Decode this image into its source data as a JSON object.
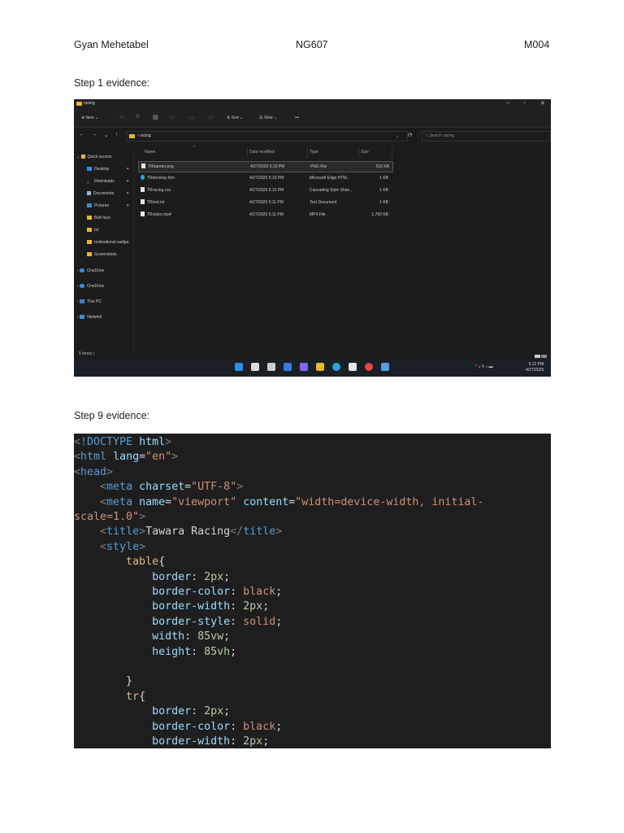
{
  "header": {
    "name": "Gyan Mehetabel",
    "code": "NG607",
    "unit": "M004"
  },
  "step1": {
    "label": "Step 1 evidence:",
    "explorer": {
      "title": "racing",
      "window_controls": [
        "–",
        "▫",
        "✕"
      ],
      "toolbar": {
        "new": "New",
        "sort": "Sort",
        "view": "View",
        "more": "•••"
      },
      "nav": {
        "back": "←",
        "forward": "→",
        "recent": "⌄",
        "up": "↑",
        "refresh": "⟳"
      },
      "address": "racing",
      "search_placeholder": "Search racing",
      "sidebar": [
        {
          "label": "Quick access",
          "icon": "star-icon"
        },
        {
          "label": "Desktop",
          "icon": "desktop-icon"
        },
        {
          "label": "Downloads",
          "icon": "download-icon"
        },
        {
          "label": "Documents",
          "icon": "document-icon"
        },
        {
          "label": "Pictures",
          "icon": "picture-icon"
        },
        {
          "label": "Butt face",
          "icon": "folder-icon"
        },
        {
          "label": "txt",
          "icon": "folder-icon"
        },
        {
          "label": "motivational wallpa",
          "icon": "folder-icon"
        },
        {
          "label": "Screenshots",
          "icon": "folder-icon"
        },
        {
          "label": "OneDrive",
          "icon": "cloud-icon"
        },
        {
          "label": "OneDrive",
          "icon": "cloud-icon"
        },
        {
          "label": "This PC",
          "icon": "pc-icon"
        },
        {
          "label": "Network",
          "icon": "network-icon"
        }
      ],
      "columns": [
        "Name",
        "Date modified",
        "Type",
        "Size"
      ],
      "files": [
        {
          "name": "TRbanner.png",
          "modified": "4/27/2025 5:10 PM",
          "type": "PNG File",
          "size": "510 KB"
        },
        {
          "name": "TRdevelop.htm",
          "modified": "4/27/2025 5:10 PM",
          "type": "Microsoft Edge HTM...",
          "size": "1 KB"
        },
        {
          "name": "TRracing.css",
          "modified": "4/27/2025 5:10 PM",
          "type": "Cascading Style Shee...",
          "size": "1 KB"
        },
        {
          "name": "TRtext.txt",
          "modified": "4/27/2025 5:11 PM",
          "type": "Text Document",
          "size": "1 KB"
        },
        {
          "name": "TRvideo.mp4",
          "modified": "4/27/2025 5:11 PM",
          "type": "MP4 File",
          "size": "1,760 KB"
        }
      ],
      "status": "5 items",
      "clock": {
        "time": "5:12 PM",
        "date": "4/27/2025"
      },
      "taskbar_colors": [
        "#2f8fe8",
        "#dddddd",
        "#cccccc",
        "#3a7bd5",
        "#7b68ee",
        "#e8b730",
        "#2fa4d8",
        "#e6e6e6",
        "#e8453c",
        "#5c9be0"
      ]
    }
  },
  "step9": {
    "label": "Step 9 evidence:",
    "code_lines": [
      [
        [
          "t-br",
          "<"
        ],
        [
          "t-tag",
          "!DOCTYPE"
        ],
        [
          "t-txt",
          " "
        ],
        [
          "t-attr",
          "html"
        ],
        [
          "t-br",
          ">"
        ]
      ],
      [
        [
          "t-br",
          "<"
        ],
        [
          "t-tag",
          "html"
        ],
        [
          "t-txt",
          " "
        ],
        [
          "t-attr",
          "lang"
        ],
        [
          "t-txt",
          "="
        ],
        [
          "t-str",
          "\"en\""
        ],
        [
          "t-br",
          ">"
        ]
      ],
      [
        [
          "t-br",
          "<"
        ],
        [
          "t-tag",
          "head"
        ],
        [
          "t-br",
          ">"
        ]
      ],
      [
        [
          "t-txt",
          "    "
        ],
        [
          "t-br",
          "<"
        ],
        [
          "t-tag",
          "meta"
        ],
        [
          "t-txt",
          " "
        ],
        [
          "t-attr",
          "charset"
        ],
        [
          "t-txt",
          "="
        ],
        [
          "t-str",
          "\"UTF-8\""
        ],
        [
          "t-br",
          ">"
        ]
      ],
      [
        [
          "t-txt",
          "    "
        ],
        [
          "t-br",
          "<"
        ],
        [
          "t-tag",
          "meta"
        ],
        [
          "t-txt",
          " "
        ],
        [
          "t-attr",
          "name"
        ],
        [
          "t-txt",
          "="
        ],
        [
          "t-str",
          "\"viewport\""
        ],
        [
          "t-txt",
          " "
        ],
        [
          "t-attr",
          "content"
        ],
        [
          "t-txt",
          "="
        ],
        [
          "t-str",
          "\"width=device-width, initial-"
        ]
      ],
      [
        [
          "t-str",
          "scale=1.0\""
        ],
        [
          "t-br",
          ">"
        ]
      ],
      [
        [
          "t-txt",
          "    "
        ],
        [
          "t-br",
          "<"
        ],
        [
          "t-tag",
          "title"
        ],
        [
          "t-br",
          ">"
        ],
        [
          "t-txt",
          "Tawara Racing"
        ],
        [
          "t-br",
          "</"
        ],
        [
          "t-tag",
          "title"
        ],
        [
          "t-br",
          ">"
        ]
      ],
      [
        [
          "t-txt",
          "    "
        ],
        [
          "t-br",
          "<"
        ],
        [
          "t-tag",
          "style"
        ],
        [
          "t-br",
          ">"
        ]
      ],
      [
        [
          "t-txt",
          "        "
        ],
        [
          "t-sel",
          "table"
        ],
        [
          "t-txt",
          "{"
        ]
      ],
      [
        [
          "t-txt",
          "            "
        ],
        [
          "t-attr",
          "border"
        ],
        [
          "t-txt",
          ": "
        ],
        [
          "t-num",
          "2px"
        ],
        [
          "t-txt",
          ";"
        ]
      ],
      [
        [
          "t-txt",
          "            "
        ],
        [
          "t-attr",
          "border-color"
        ],
        [
          "t-txt",
          ": "
        ],
        [
          "t-str",
          "black"
        ],
        [
          "t-txt",
          ";"
        ]
      ],
      [
        [
          "t-txt",
          "            "
        ],
        [
          "t-attr",
          "border-width"
        ],
        [
          "t-txt",
          ": "
        ],
        [
          "t-num",
          "2px"
        ],
        [
          "t-txt",
          ";"
        ]
      ],
      [
        [
          "t-txt",
          "            "
        ],
        [
          "t-attr",
          "border-style"
        ],
        [
          "t-txt",
          ": "
        ],
        [
          "t-str",
          "solid"
        ],
        [
          "t-txt",
          ";"
        ]
      ],
      [
        [
          "t-txt",
          "            "
        ],
        [
          "t-attr",
          "width"
        ],
        [
          "t-txt",
          ": "
        ],
        [
          "t-num",
          "85vw"
        ],
        [
          "t-txt",
          ";"
        ]
      ],
      [
        [
          "t-txt",
          "            "
        ],
        [
          "t-attr",
          "height"
        ],
        [
          "t-txt",
          ": "
        ],
        [
          "t-num",
          "85vh"
        ],
        [
          "t-txt",
          ";"
        ]
      ],
      [],
      [
        [
          "t-txt",
          "        }"
        ]
      ],
      [
        [
          "t-txt",
          "        "
        ],
        [
          "t-sel",
          "tr"
        ],
        [
          "t-txt",
          "{"
        ]
      ],
      [
        [
          "t-txt",
          "            "
        ],
        [
          "t-attr",
          "border"
        ],
        [
          "t-txt",
          ": "
        ],
        [
          "t-num",
          "2px"
        ],
        [
          "t-txt",
          ";"
        ]
      ],
      [
        [
          "t-txt",
          "            "
        ],
        [
          "t-attr",
          "border-color"
        ],
        [
          "t-txt",
          ": "
        ],
        [
          "t-str",
          "black"
        ],
        [
          "t-txt",
          ";"
        ]
      ],
      [
        [
          "t-txt",
          "            "
        ],
        [
          "t-attr",
          "border-width"
        ],
        [
          "t-txt",
          ": "
        ],
        [
          "t-num",
          "2px"
        ],
        [
          "t-txt",
          ";"
        ]
      ]
    ]
  }
}
